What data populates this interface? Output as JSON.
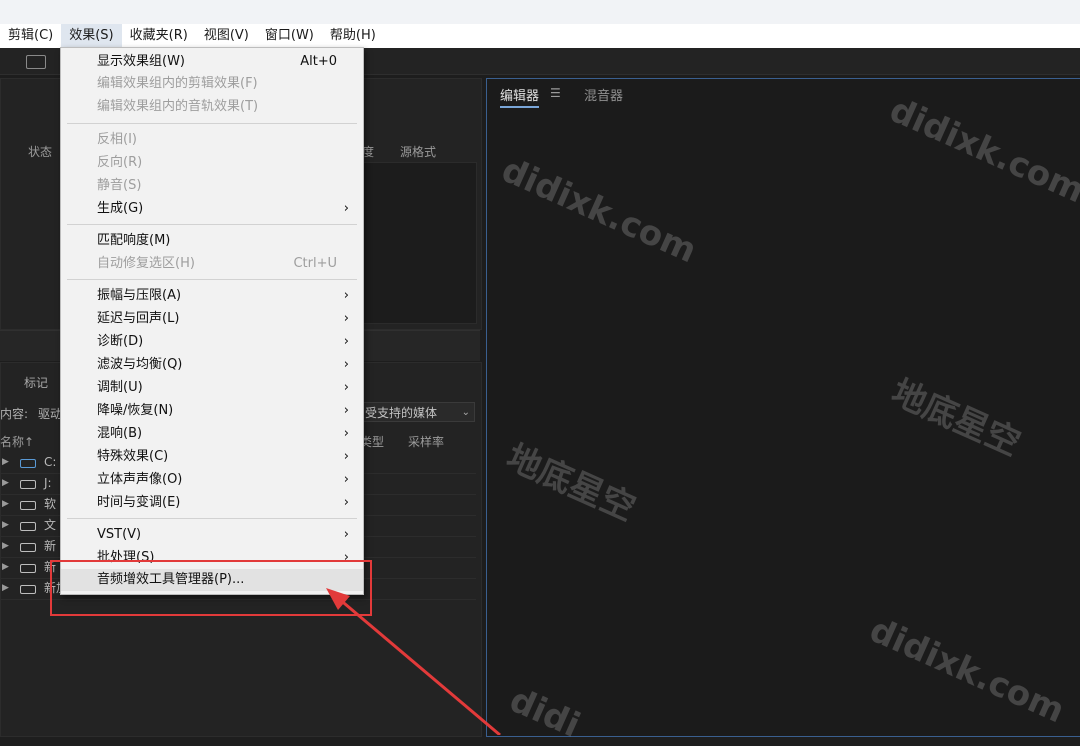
{
  "menubar": {
    "items": [
      "剪辑(C)",
      "效果(S)",
      "收藏夹(R)",
      "视图(V)",
      "窗口(W)",
      "帮助(H)"
    ]
  },
  "files_panel": {
    "columns": [
      "状态",
      "度",
      "源格式"
    ]
  },
  "media_panel": {
    "tab": "标记",
    "content_label": "内容:",
    "content_value": "驱动",
    "dropdown_value": "受支持的媒体",
    "columns": [
      "名称↑",
      "类型",
      "采样率"
    ],
    "drives": [
      "C:",
      "J:",
      "软",
      "文",
      "新",
      "新",
      "新加卷 (E:)"
    ]
  },
  "editor": {
    "tabs": [
      "编辑器",
      "混音器"
    ]
  },
  "effects_menu": {
    "items": [
      {
        "label": "显示效果组(W)",
        "shortcut": "Alt+0"
      },
      {
        "label": "编辑效果组内的剪辑效果(F)"
      },
      {
        "label": "编辑效果组内的音轨效果(T)"
      },
      {
        "label": "反相(I)"
      },
      {
        "label": "反向(R)"
      },
      {
        "label": "静音(S)"
      },
      {
        "label": "生成(G)"
      },
      {
        "label": "匹配响度(M)"
      },
      {
        "label": "自动修复选区(H)",
        "shortcut": "Ctrl+U"
      },
      {
        "label": "振幅与压限(A)"
      },
      {
        "label": "延迟与回声(L)"
      },
      {
        "label": "诊断(D)"
      },
      {
        "label": "滤波与均衡(Q)"
      },
      {
        "label": "调制(U)"
      },
      {
        "label": "降噪/恢复(N)"
      },
      {
        "label": "混响(B)"
      },
      {
        "label": "特殊效果(C)"
      },
      {
        "label": "立体声声像(O)"
      },
      {
        "label": "时间与变调(E)"
      },
      {
        "label": "VST(V)"
      },
      {
        "label": "批处理(S)"
      },
      {
        "label": "音频增效工具管理器(P)..."
      }
    ]
  },
  "watermarks": [
    "didixk.com",
    "地底星空",
    "didixk.com",
    "地底星空",
    "didixk.com",
    "didi"
  ],
  "colors": {
    "annotation_red": "#e23a3a",
    "editor_border": "#3a5f8f"
  }
}
